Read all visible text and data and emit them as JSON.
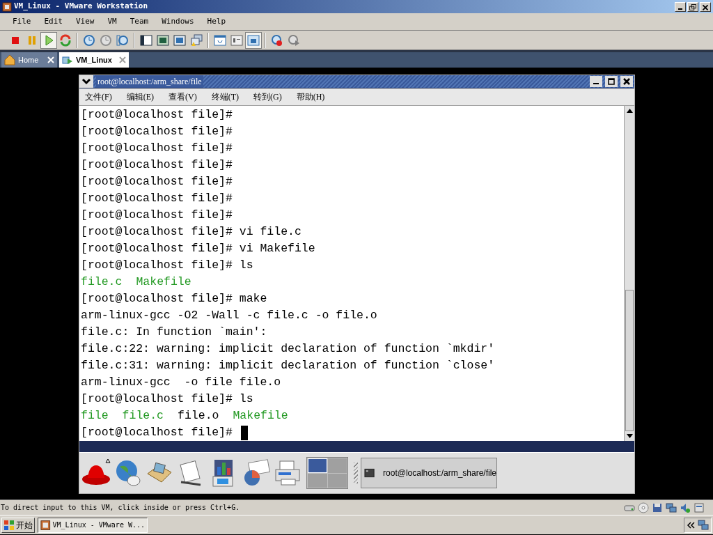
{
  "window": {
    "title": "VM_Linux - VMware Workstation"
  },
  "menu": [
    "File",
    "Edit",
    "View",
    "VM",
    "Team",
    "Windows",
    "Help"
  ],
  "toolbar": [
    [
      {
        "kind": "stop",
        "pressed": false
      },
      {
        "kind": "pause",
        "pressed": false
      },
      {
        "kind": "play",
        "pressed": true
      },
      {
        "kind": "reset",
        "pressed": false
      }
    ],
    [
      {
        "kind": "snapshot",
        "pressed": false
      },
      {
        "kind": "revert",
        "pressed": false
      },
      {
        "kind": "manager",
        "pressed": false
      }
    ],
    [
      {
        "kind": "sidebar",
        "pressed": false
      },
      {
        "kind": "fullscreen",
        "pressed": false
      },
      {
        "kind": "quickswitch",
        "pressed": false
      },
      {
        "kind": "unity",
        "pressed": false
      }
    ],
    [
      {
        "kind": "console",
        "pressed": false
      },
      {
        "kind": "summary",
        "pressed": false
      },
      {
        "kind": "view",
        "pressed": true
      }
    ],
    [
      {
        "kind": "record",
        "pressed": false
      },
      {
        "kind": "replay",
        "pressed": false
      }
    ]
  ],
  "tabs": [
    {
      "label": "Home",
      "selected": false
    },
    {
      "label": "VM_Linux",
      "selected": true
    }
  ],
  "guest": {
    "title": "root@localhost:/arm_share/file",
    "menu": [
      "文件(F)",
      "编辑(E)",
      "查看(V)",
      "终端(T)",
      "转到(G)",
      "帮助(H)"
    ],
    "terminal": [
      [
        {
          "text": "[root@localhost file]#",
          "color": "#000000"
        }
      ],
      [
        {
          "text": "[root@localhost file]#",
          "color": "#000000"
        }
      ],
      [
        {
          "text": "[root@localhost file]#",
          "color": "#000000"
        }
      ],
      [
        {
          "text": "[root@localhost file]#",
          "color": "#000000"
        }
      ],
      [
        {
          "text": "[root@localhost file]#",
          "color": "#000000"
        }
      ],
      [
        {
          "text": "[root@localhost file]#",
          "color": "#000000"
        }
      ],
      [
        {
          "text": "[root@localhost file]#",
          "color": "#000000"
        }
      ],
      [
        {
          "text": "[root@localhost file]# vi file.c",
          "color": "#000000"
        }
      ],
      [
        {
          "text": "[root@localhost file]# vi Makefile",
          "color": "#000000"
        }
      ],
      [
        {
          "text": "[root@localhost file]# ls",
          "color": "#000000"
        }
      ],
      [
        {
          "text": "file.c",
          "color": "#229922"
        },
        {
          "text": "Makefile",
          "color": "#229922"
        }
      ],
      [
        {
          "text": "[root@localhost file]# make",
          "color": "#000000"
        }
      ],
      [
        {
          "text": "arm-linux-gcc -O2 -Wall -c file.c -o file.o",
          "color": "#000000"
        }
      ],
      [
        {
          "text": "file.c: In function `main':",
          "color": "#000000"
        }
      ],
      [
        {
          "text": "file.c:22: warning: implicit declaration of function `mkdir'",
          "color": "#000000"
        }
      ],
      [
        {
          "text": "file.c:31: warning: implicit declaration of function `close'",
          "color": "#000000"
        }
      ],
      [
        {
          "text": "arm-linux-gcc  -o file file.o",
          "color": "#000000"
        }
      ],
      [
        {
          "text": "[root@localhost file]# ls",
          "color": "#000000"
        }
      ],
      [
        {
          "text": "file",
          "color": "#229922"
        },
        {
          "text": "file.c",
          "color": "#229922"
        },
        {
          "text": "file.o",
          "color": "#000000"
        },
        {
          "text": "Makefile",
          "color": "#229922"
        }
      ],
      [
        {
          "text": "[root@localhost file]#",
          "color": "#000000"
        }
      ]
    ],
    "cursor": true,
    "workspaces": [
      {
        "selected": true
      },
      {
        "selected": false
      },
      {
        "selected": false
      },
      {
        "selected": false
      }
    ],
    "task": "root@localhost:/arm_share/file"
  },
  "status_bar": "To direct input to this VM, click inside or press Ctrl+G.",
  "taskbar": {
    "start": "开始",
    "task": "VM_Linux - VMware W..."
  }
}
